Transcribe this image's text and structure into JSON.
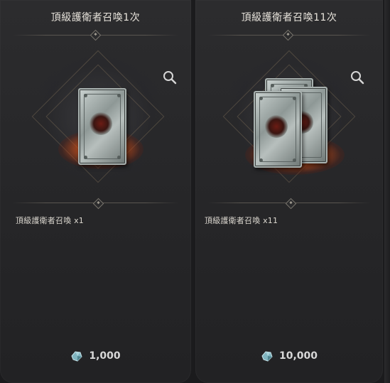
{
  "packages": [
    {
      "title": "頂級護衛者召喚1次",
      "item_label": "頂級護衛者召喚 x1",
      "price": "1,000",
      "zoom_icon": "magnifier-icon",
      "currency_icon": "crystal-gem-icon",
      "card_count": 1
    },
    {
      "title": "頂級護衛者召喚11次",
      "item_label": "頂級護衛者召喚 x11",
      "price": "10,000",
      "zoom_icon": "magnifier-icon",
      "currency_icon": "crystal-gem-icon",
      "card_count": 3
    }
  ],
  "colors": {
    "panel_bg": "#2a2a2c",
    "title_text": "#e8e4dc",
    "glow_orange": "#ff9a2e",
    "card_silver": "#b7bfbd"
  }
}
